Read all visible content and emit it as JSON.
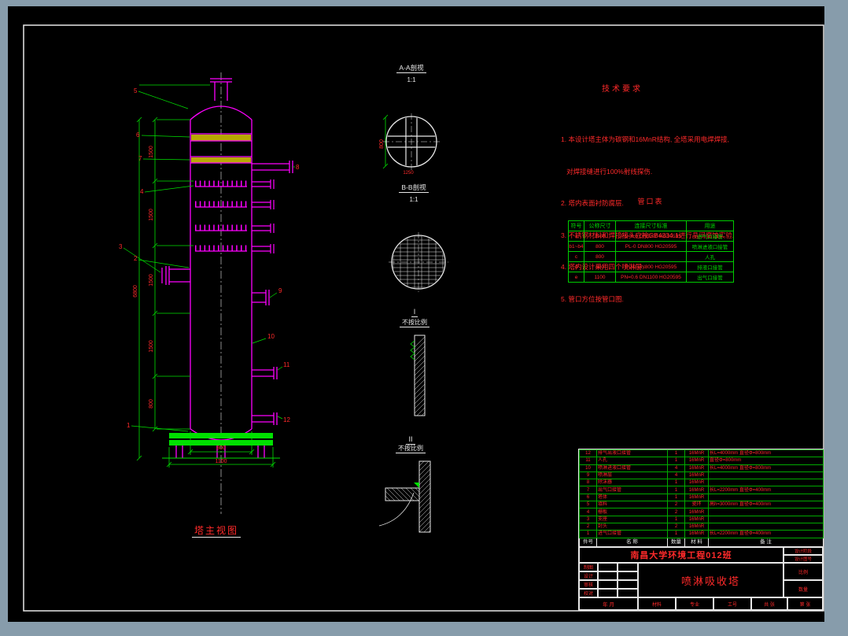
{
  "canvas": {
    "bg": "#879cab",
    "paper": "#000000"
  },
  "palette": {
    "magenta": "#ff00ff",
    "green": "#00e000",
    "red": "#ff2a2a",
    "yellow": "#b9a800",
    "white": "#e8e8e8"
  },
  "views": {
    "main": {
      "title": "塔主视图"
    },
    "aa": {
      "title": "A-A剖视",
      "scale": "1:1",
      "dim_v": "800",
      "dim_b": "1250"
    },
    "bb": {
      "title": "B-B剖视",
      "scale": "1:1"
    },
    "detail1": {
      "label": "I",
      "note": "不按比例"
    },
    "detail2": {
      "label": "II",
      "note": "不按比例"
    }
  },
  "tower": {
    "balloons": [
      "5",
      "6",
      "7",
      "4",
      "3",
      "2",
      "1",
      "8",
      "9",
      "10",
      "11",
      "12"
    ],
    "dims": {
      "segments": [
        "1500",
        "1500",
        "1500",
        "1500"
      ],
      "bottom_segment": "800",
      "overall": "6800",
      "inner_dia": "800",
      "base_width": "1100"
    }
  },
  "tech": {
    "title": "技术要求",
    "lines": [
      "1. 本设计塔主体为碳钢和16MnR结构, 全塔采用电焊焊接,",
      "   对焊接缝进行100%射线探伤.",
      "2. 塔内表面衬防腐层.",
      "3. 不锈钢材料和焊接接头应按GB4334.1进行晶间腐蚀实验.",
      "4. 塔内设计采用四个喷淋层.",
      "5. 管口方位按管口图."
    ]
  },
  "nozzle_table": {
    "title": "管口表",
    "headers": [
      "符号",
      "公称尺寸",
      "连接尺寸标准",
      "用途"
    ],
    "rows": [
      [
        "a",
        "1100",
        "PN=0.6 DN1100 HG20595",
        "进气口接管"
      ],
      [
        "b1~b4",
        "800",
        "PL-0 DN800 HG20595",
        "喷淋进液口接管"
      ],
      [
        "c",
        "800",
        "",
        "人孔"
      ],
      [
        "d",
        "800",
        "PL-0 DN800 HG20595",
        "排液口接管"
      ],
      [
        "e",
        "1100",
        "PN=0.6 DN1100 HG20595",
        "出气口接管"
      ]
    ]
  },
  "parts_list": {
    "headers": [
      "件号",
      "名  称",
      "数量",
      "材  料",
      "备  注"
    ],
    "rows": [
      [
        "12",
        "排气出液口接管",
        "1",
        "16MnR",
        "长L=4000mm 直径Φ=800mm"
      ],
      [
        "11",
        "人孔",
        "1",
        "16MnR",
        "直径Φ=800mm"
      ],
      [
        "10",
        "喷淋进液口接管",
        "4",
        "16MnR",
        "长L=4000mm 直径Φ=800mm"
      ],
      [
        "9",
        "喷淋层",
        "4",
        "16MnR",
        ""
      ],
      [
        "8",
        "除沫器",
        "1",
        "16MnR",
        ""
      ],
      [
        "7",
        "出气口接管",
        "1",
        "16MnR",
        "长L=2200mm 直径Φ=400mm"
      ],
      [
        "6",
        "塔体",
        "1",
        "16MnR",
        ""
      ],
      [
        "5",
        "填料",
        "2",
        "瓷环",
        "高h=3000mm 直径Φ=400mm"
      ],
      [
        "4",
        "栅板",
        "2",
        "16MnR",
        ""
      ],
      [
        "3",
        "支座",
        "1",
        "16MnR",
        ""
      ],
      [
        "2",
        "封头",
        "2",
        "16MnR",
        ""
      ],
      [
        "1",
        "进气口接管",
        "1",
        "16MnR",
        "长L=2200mm 直径Φ=400mm"
      ]
    ]
  },
  "title_block": {
    "school": "南昌大学环境工程012班",
    "product": "喷淋吸收塔",
    "sign_rows": [
      "制图",
      "设计",
      "审核",
      "校对"
    ],
    "stage_label": "设计阶段",
    "number_label": "设计图号",
    "scale_label": "比例",
    "qty_label": "数量",
    "date_label": "年  月",
    "material_label": "材料",
    "major_label": "专业",
    "job_label": "工号",
    "sheets_label": "共  张",
    "sheet_label": "第  张"
  }
}
